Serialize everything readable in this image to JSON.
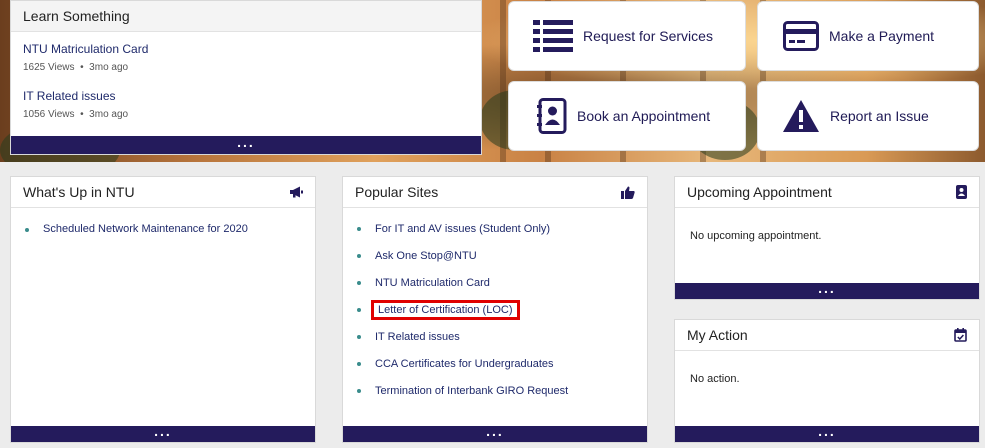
{
  "learn": {
    "title": "Learn Something",
    "items": [
      {
        "title": "NTU Matriculation Card",
        "views": "1625 Views",
        "sep": "•",
        "ago": "3mo ago"
      },
      {
        "title": "IT Related issues",
        "views": "1056 Views",
        "sep": "•",
        "ago": "3mo ago"
      }
    ],
    "more": "..."
  },
  "tiles": {
    "request": "Request for Services",
    "payment": "Make a Payment",
    "appointment": "Book an Appointment",
    "issue": "Report an Issue"
  },
  "whatsup": {
    "title": "What's Up in NTU",
    "items": [
      "Scheduled Network Maintenance for 2020"
    ],
    "more": "..."
  },
  "popular": {
    "title": "Popular Sites",
    "items": [
      "For IT and AV issues (Student Only)",
      "Ask One Stop@NTU",
      "NTU Matriculation Card",
      "Letter of Certification (LOC)",
      "IT Related issues",
      "CCA Certificates for Undergraduates",
      "Termination of Interbank GIRO Request"
    ],
    "more": "..."
  },
  "upcoming": {
    "title": "Upcoming Appointment",
    "message": "No upcoming appointment.",
    "more": "..."
  },
  "myaction": {
    "title": "My Action",
    "message": "No action.",
    "more": "..."
  },
  "colors": {
    "accent": "#241b5c",
    "highlight": "#e00000",
    "bullet": "#3a8c8c"
  }
}
